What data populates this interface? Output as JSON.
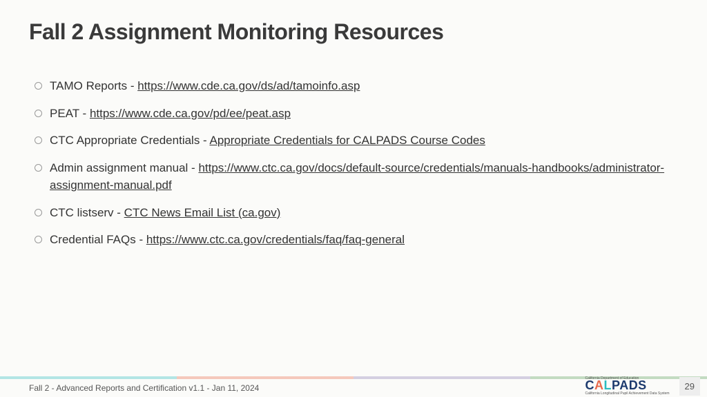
{
  "title": "Fall 2 Assignment Monitoring Resources",
  "items": [
    {
      "prefix": "TAMO Reports - ",
      "link": "https://www.cde.ca.gov/ds/ad/tamoinfo.asp",
      "suffix": ""
    },
    {
      "prefix": "PEAT - ",
      "link": "https://www.cde.ca.gov/pd/ee/peat.asp",
      "suffix": ""
    },
    {
      "prefix": "CTC Appropriate Credentials - ",
      "link": "Appropriate Credentials for CALPADS Course Codes",
      "suffix": ""
    },
    {
      "prefix": "Admin assignment manual - ",
      "link": "https://www.ctc.ca.gov/docs/default-source/credentials/manuals-handbooks/administrator-assignment-manual.pdf",
      "suffix": ""
    },
    {
      "prefix": "CTC listserv - ",
      "link": "CTC News Email List (ca.gov)",
      "suffix": ""
    },
    {
      "prefix": "Credential FAQs - ",
      "link": "https://www.ctc.ca.gov/credentials/faq/faq-general",
      "suffix": ""
    }
  ],
  "footer": {
    "text": "Fall 2 - Advanced Reports and Certification v1.1 - Jan 11, 2024",
    "logo_top": "California Department of Education",
    "logo_main": "CALPADS",
    "logo_sub": "California Longitudinal Pupil Achievement Data System",
    "page": "29"
  }
}
